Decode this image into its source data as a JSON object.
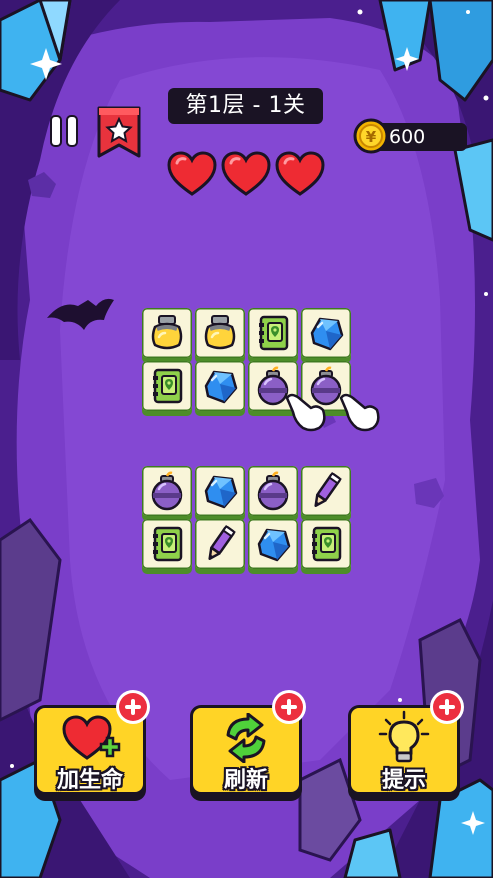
{
  "hud": {
    "level_title": "第1层 - 1关",
    "coins": "600",
    "lives": 3
  },
  "board": {
    "top_group": [
      [
        "lamp-icon",
        "lamp-icon",
        "green-book-icon",
        "blue-gem-icon"
      ],
      [
        "green-book-icon",
        "blue-gem-icon",
        "bomb-icon",
        "bomb-icon"
      ]
    ],
    "bottom_group": [
      [
        "bomb-icon",
        "blue-gem-icon",
        "bomb-icon",
        "purple-pencil-icon"
      ],
      [
        "green-book-icon",
        "purple-pencil-icon",
        "blue-gem-icon",
        "green-book-icon"
      ]
    ]
  },
  "powerups": [
    {
      "label": "加生命",
      "icon": "heart-plus-icon"
    },
    {
      "label": "刷新",
      "icon": "refresh-icon"
    },
    {
      "label": "提示",
      "icon": "lightbulb-icon"
    }
  ],
  "colors": {
    "background": "#7a3ec9",
    "tile_face": "#f9f5d9",
    "tile_edge": "#4d8d29",
    "button_face": "#ffd426",
    "badge_red": "#ec2f3f"
  }
}
